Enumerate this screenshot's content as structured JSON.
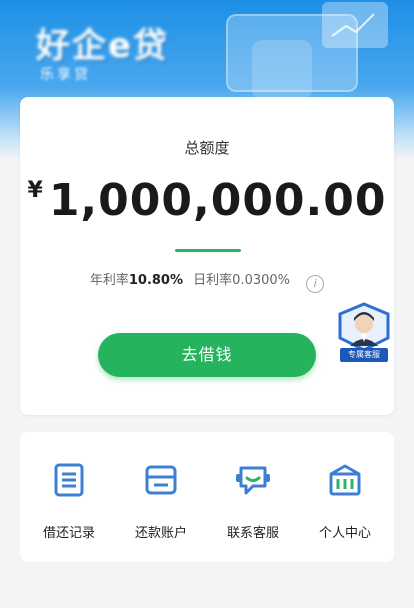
{
  "header": {
    "logo_title": "好企e贷",
    "logo_sub": "乐享贷"
  },
  "credit": {
    "total_label": "总额度",
    "currency_symbol": "¥",
    "amount": "1,000,000.00",
    "annual_rate_label": "年利率",
    "annual_rate_value": "10.80%",
    "daily_rate_label": "日利率",
    "daily_rate_value": "0.0300%",
    "borrow_button": "去借钱"
  },
  "agent": {
    "label": "专属客服"
  },
  "shortcuts": [
    {
      "label": "借还记录",
      "icon": "records-icon"
    },
    {
      "label": "还款账户",
      "icon": "card-icon"
    },
    {
      "label": "联系客服",
      "icon": "chat-icon"
    },
    {
      "label": "个人中心",
      "icon": "bank-icon"
    }
  ],
  "colors": {
    "primary_blue": "#3d7fd0",
    "accent_green": "#25b35d",
    "header_blue": "#1e8fe6"
  }
}
